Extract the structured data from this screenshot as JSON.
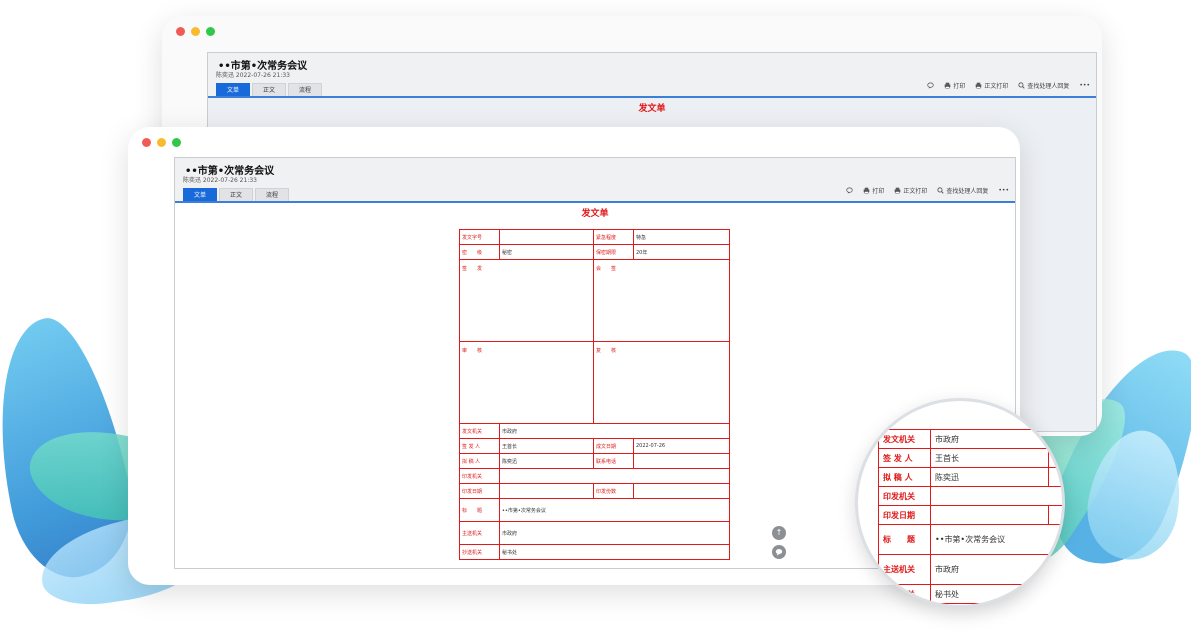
{
  "doc": {
    "title": "••市第•次常务会议",
    "meta": "陈奕迅 2022-07-26 21:33",
    "heading": "发文单"
  },
  "tabs": [
    "文单",
    "正文",
    "流程"
  ],
  "toolbar": {
    "print": "打印",
    "body_print": "正文打印",
    "find": "查找处理人回复",
    "more": "•••"
  },
  "form": {
    "doc_number_label": "发文字号",
    "doc_number_value": "",
    "urgency_label": "紧急程度",
    "urgency_value": "特急",
    "secret_label": "密　　级",
    "secret_value": "秘密",
    "secret_period_label": "保密期限",
    "secret_period_value": "20年",
    "sign_label": "签　　发",
    "countersign_label": "会　　签",
    "review_label": "审　　核",
    "recheck_label": "复　　核",
    "issuer_label": "发文机关",
    "issuer_value": "市政府",
    "signer_label": "签 发 人",
    "signer_value": "王首长",
    "date_label": "成文日期",
    "date_value": "2022-07-26",
    "drafter_label": "拟 稿 人",
    "drafter_value": "陈奕迅",
    "phone_label": "联系电话",
    "phone_value": "",
    "print_org_label": "印发机关",
    "print_org_value": "",
    "print_date_label": "印发日期",
    "print_date_value": "",
    "copies_label": "印发份数",
    "copies_value": "",
    "subject_label": "标　　题",
    "subject_value": "••市第•次常务会议",
    "main_to_label": "主送机关",
    "main_to_value": "市政府",
    "cc_label": "抄送机关",
    "cc_value": "秘书处"
  }
}
